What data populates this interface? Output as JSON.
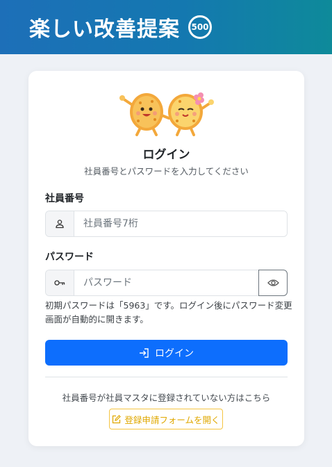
{
  "header": {
    "title": "楽しい改善提案",
    "badge": "500"
  },
  "login": {
    "title": "ログイン",
    "subtitle": "社員番号とパスワードを入力してください",
    "employee_label": "社員番号",
    "employee_placeholder": "社員番号7桁",
    "employee_value": "",
    "password_label": "パスワード",
    "password_placeholder": "パスワード",
    "password_value": "",
    "hint": "初期パスワードは「5963」です。ログイン後にパスワード変更画面が自動的に開きます。",
    "submit_label": "ログイン"
  },
  "register": {
    "note": "社員番号が社員マスタに登録されていない方はこちら",
    "button_label": "登録申請フォームを開く"
  },
  "icons": {
    "employee_field": "person-icon",
    "password_field": "key-icon",
    "toggle": "eye-icon",
    "login_button": "sign-in-icon",
    "register_button": "pencil-square-icon"
  },
  "colors": {
    "primary": "#0d6efd",
    "header_start": "#1d6fb8",
    "header_end": "#0e8a9a",
    "register_accent": "#f5c542"
  }
}
